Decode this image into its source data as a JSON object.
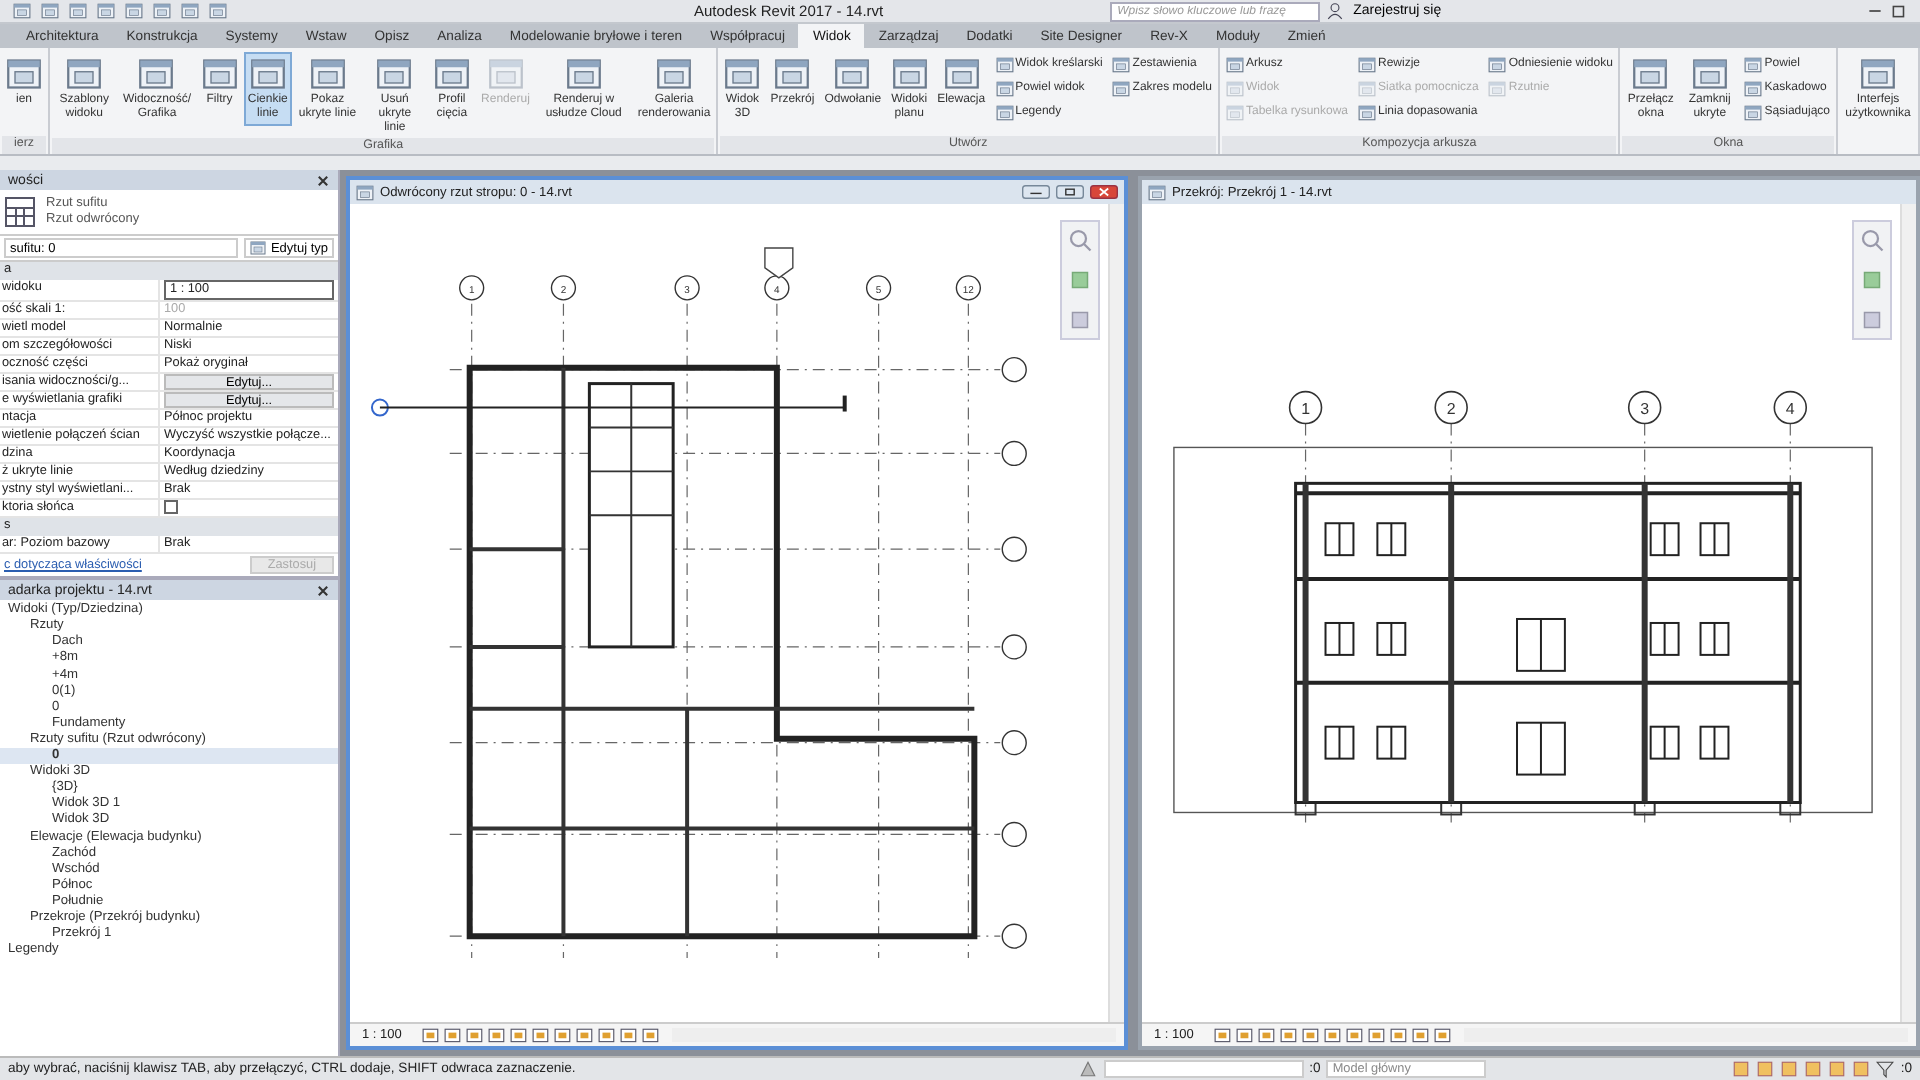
{
  "title_bar": {
    "title": "Autodesk Revit 2017 -  14.rvt",
    "search": {
      "placeholder": "Wpisz słowo kluczowe lub frazę"
    },
    "sign_in": "Zarejestruj się"
  },
  "ribbon_tabs": [
    {
      "label": "Architektura",
      "selected": false
    },
    {
      "label": "Konstrukcja",
      "selected": false
    },
    {
      "label": "Systemy",
      "selected": false
    },
    {
      "label": "Wstaw",
      "selected": false
    },
    {
      "label": "Opisz",
      "selected": false
    },
    {
      "label": "Analiza",
      "selected": false
    },
    {
      "label": "Modelowanie bryłowe i teren",
      "selected": false
    },
    {
      "label": "Współpracuj",
      "selected": false
    },
    {
      "label": "Widok",
      "selected": true
    },
    {
      "label": "Zarządzaj",
      "selected": false
    },
    {
      "label": "Dodatki",
      "selected": false
    },
    {
      "label": "Site Designer",
      "selected": false
    },
    {
      "label": "Rev-X",
      "selected": false
    },
    {
      "label": "Moduły",
      "selected": false
    },
    {
      "label": "Zmień",
      "selected": false
    }
  ],
  "ribbon_panels": [
    {
      "title": "ierz",
      "tools": [
        {
          "label": "ien",
          "kind": "large",
          "selected": false,
          "disabled": false
        }
      ]
    },
    {
      "title": "Grafika",
      "tools": [
        {
          "label": "Szablony widoku",
          "kind": "large",
          "selected": false,
          "disabled": false
        },
        {
          "label": "Widoczność/ Grafika",
          "kind": "large",
          "selected": false,
          "disabled": false
        },
        {
          "label": "Filtry",
          "kind": "large",
          "selected": false,
          "disabled": false
        },
        {
          "label": "Cienkie linie",
          "kind": "large",
          "selected": true,
          "disabled": false
        },
        {
          "label": "Pokaz ukryte linie",
          "kind": "large",
          "selected": false,
          "disabled": false
        },
        {
          "label": "Usuń ukryte linie",
          "kind": "large",
          "selected": false,
          "disabled": false
        },
        {
          "label": "Profil cięcia",
          "kind": "large",
          "selected": false,
          "disabled": false
        },
        {
          "label": "Renderuj",
          "kind": "large",
          "selected": false,
          "disabled": true
        },
        {
          "label": "Renderuj w usłudze Cloud",
          "kind": "large",
          "selected": false,
          "disabled": false
        },
        {
          "label": "Galeria renderowania",
          "kind": "large",
          "selected": false,
          "disabled": false
        }
      ]
    },
    {
      "title": "Utwórz",
      "tools": [
        {
          "label": "Widok 3D",
          "kind": "large",
          "selected": false,
          "disabled": false
        },
        {
          "label": "Przekrój",
          "kind": "large",
          "selected": false,
          "disabled": false
        },
        {
          "label": "Odwołanie",
          "kind": "large",
          "selected": false,
          "disabled": false
        },
        {
          "label": "Widoki planu",
          "kind": "large",
          "selected": false,
          "disabled": false
        },
        {
          "label": "Elewacja",
          "kind": "large",
          "selected": false,
          "disabled": false
        },
        {
          "label": "Widok kreślarski",
          "kind": "small",
          "selected": false,
          "disabled": false
        },
        {
          "label": "Powiel widok",
          "kind": "small",
          "selected": false,
          "disabled": false
        },
        {
          "label": "Legendy",
          "kind": "small",
          "selected": false,
          "disabled": false
        },
        {
          "label": "Zestawienia",
          "kind": "small",
          "selected": false,
          "disabled": false
        },
        {
          "label": "Zakres modelu",
          "kind": "small",
          "selected": false,
          "disabled": false
        }
      ]
    },
    {
      "title": "Kompozycja arkusza",
      "tools": [
        {
          "label": "Arkusz",
          "kind": "small",
          "selected": false,
          "disabled": false
        },
        {
          "label": "Widok",
          "kind": "small",
          "selected": false,
          "disabled": true
        },
        {
          "label": "Tabelka rysunkowa",
          "kind": "small",
          "selected": false,
          "disabled": true
        },
        {
          "label": "Rewizje",
          "kind": "small",
          "selected": false,
          "disabled": false
        },
        {
          "label": "Siatka pomocnicza",
          "kind": "small",
          "selected": false,
          "disabled": true
        },
        {
          "label": "Linia dopasowania",
          "kind": "small",
          "selected": false,
          "disabled": false
        },
        {
          "label": "Odniesienie widoku",
          "kind": "small",
          "selected": false,
          "disabled": false
        },
        {
          "label": "Rzutnie",
          "kind": "small",
          "selected": false,
          "disabled": true
        }
      ]
    },
    {
      "title": "Okna",
      "tools": [
        {
          "label": "Przełącz okna",
          "kind": "large",
          "selected": false,
          "disabled": false
        },
        {
          "label": "Zamknij ukryte",
          "kind": "large",
          "selected": false,
          "disabled": false
        },
        {
          "label": "Powiel",
          "kind": "small",
          "selected": false,
          "disabled": false
        },
        {
          "label": "Kaskadowo",
          "kind": "small",
          "selected": false,
          "disabled": false
        },
        {
          "label": "Sąsiadująco",
          "kind": "small",
          "selected": false,
          "disabled": false
        }
      ]
    },
    {
      "tools": [
        {
          "label": "Interfejs użytkownika",
          "kind": "large",
          "selected": false,
          "disabled": false
        }
      ]
    }
  ],
  "properties": {
    "title": "wości",
    "type_family": "Rzut sufitu",
    "type_name": "Rzut odwrócony",
    "instance": "sufitu: 0",
    "edit_type": "Edytuj typ",
    "rows": [
      {
        "kind": "section",
        "name": "a"
      },
      {
        "kind": "field",
        "name": "widoku",
        "value": "1 : 100"
      },
      {
        "kind": "dim",
        "name": "ość skali  1:",
        "value": "100"
      },
      {
        "kind": "text",
        "name": "wietl model",
        "value": "Normalnie"
      },
      {
        "kind": "text",
        "name": "om szczegółowości",
        "value": "Niski"
      },
      {
        "kind": "text",
        "name": "oczność części",
        "value": "Pokaż oryginał"
      },
      {
        "kind": "button",
        "name": "isania widoczności/g...",
        "value": "Edytuj..."
      },
      {
        "kind": "button",
        "name": "e wyświetlania grafiki",
        "value": "Edytuj..."
      },
      {
        "kind": "text",
        "name": "ntacja",
        "value": "Północ projektu"
      },
      {
        "kind": "text",
        "name": "wietlenie połączeń ścian",
        "value": "Wyczyść wszystkie połącze..."
      },
      {
        "kind": "text",
        "name": "dzina",
        "value": "Koordynacja"
      },
      {
        "kind": "text",
        "name": "ż ukryte linie",
        "value": "Według dziedziny"
      },
      {
        "kind": "text",
        "name": "ystny styl wyświetlani...",
        "value": "Brak"
      },
      {
        "kind": "checkbox",
        "name": "ktoria słońca",
        "checked": false
      },
      {
        "kind": "section",
        "name": "s"
      },
      {
        "kind": "text",
        "name": "ar: Poziom bazowy",
        "value": "Brak"
      }
    ],
    "help_link": "c dotycząca właściwości",
    "apply": "Zastosuj"
  },
  "project_browser": {
    "title": "adarka projektu - 14.rvt",
    "tree": [
      {
        "label": "Widoki (Typ/Dziedzina)",
        "selected": false,
        "children": [
          {
            "label": "Rzuty",
            "selected": false,
            "children": [
              {
                "label": "Dach",
                "selected": false
              },
              {
                "label": "+8m",
                "selected": false
              },
              {
                "label": "+4m",
                "selected": false
              },
              {
                "label": "0(1)",
                "selected": false
              },
              {
                "label": "0",
                "selected": false
              },
              {
                "label": "Fundamenty",
                "selected": false
              }
            ]
          },
          {
            "label": "Rzuty sufitu (Rzut odwrócony)",
            "selected": false,
            "children": [
              {
                "label": "0",
                "selected": true
              }
            ]
          },
          {
            "label": "Widoki 3D",
            "selected": false,
            "children": [
              {
                "label": "{3D}",
                "selected": false
              },
              {
                "label": "Widok 3D 1",
                "selected": false
              },
              {
                "label": "Widok 3D",
                "selected": false
              }
            ]
          },
          {
            "label": "Elewacje (Elewacja budynku)",
            "selected": false,
            "children": [
              {
                "label": "Zachód",
                "selected": false
              },
              {
                "label": "Wschód",
                "selected": false
              },
              {
                "label": "Północ",
                "selected": false
              },
              {
                "label": "Południe",
                "selected": false
              }
            ]
          },
          {
            "label": "Przekroje (Przekrój budynku)",
            "selected": false,
            "children": [
              {
                "label": "Przekrój 1",
                "selected": false
              }
            ]
          }
        ]
      },
      {
        "label": "Legendy",
        "selected": false
      }
    ]
  },
  "views": [
    {
      "title": "Odwrócony rzut stropu: 0 - 14.rvt",
      "kind": "plan",
      "active": true,
      "scale": "1 : 100",
      "grid_labels": [
        "1",
        "2",
        "3",
        "4",
        "5",
        "12"
      ]
    },
    {
      "title": "Przekrój: Przekrój 1 - 14.rvt",
      "kind": "section",
      "active": false,
      "scale": "1 : 100",
      "grid_labels": [
        "1",
        "2",
        "3",
        "4"
      ]
    }
  ],
  "status_bar": {
    "message": "aby wybrać, naciśnij klawisz TAB, aby przełączyć, CTRL dodaje, SHIFT odwraca zaznaczenie.",
    "workset_count": ":0",
    "design_option": "Model główny",
    "filter_count": ":0"
  }
}
